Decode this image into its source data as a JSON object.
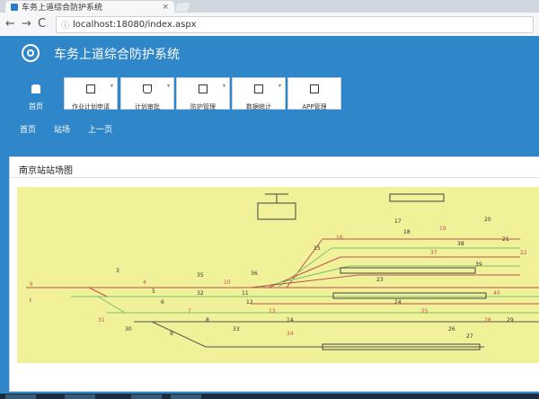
{
  "browser": {
    "tab_title": "车务上道综合防护系统",
    "tab_close": "×",
    "back": "←",
    "forward": "→",
    "reload": "C",
    "url_info": "ⓘ",
    "url": "localhost:18080/index.aspx"
  },
  "header": {
    "title": "车务上道综合防护系统"
  },
  "menu": {
    "home_label": "首页",
    "items": [
      {
        "label": "作业计划申请"
      },
      {
        "label": "计划审批"
      },
      {
        "label": "防护管理"
      },
      {
        "label": "数据统计"
      },
      {
        "label": "APP管理"
      }
    ],
    "dropdown": "▾"
  },
  "subnav": {
    "items": [
      "首页",
      "站场",
      "上一页"
    ]
  },
  "panel": {
    "title": "南京站站场图"
  },
  "diagram": {
    "line_colors": {
      "red": "#c0504d",
      "green": "#7ac36a",
      "gray": "#555555"
    },
    "labels": [
      "II",
      "I",
      "3",
      "4",
      "5",
      "6",
      "7",
      "8",
      "9",
      "10",
      "11",
      "12",
      "13",
      "14",
      "15",
      "16",
      "17",
      "18",
      "19",
      "20",
      "21",
      "22",
      "23",
      "24",
      "25",
      "26",
      "27",
      "28",
      "29",
      "30",
      "31",
      "32",
      "33",
      "34",
      "35",
      "36",
      "37",
      "38",
      "39",
      "40"
    ]
  },
  "colors": {
    "header": "#2f86c9",
    "diagram_bg": "#f1f19a"
  }
}
